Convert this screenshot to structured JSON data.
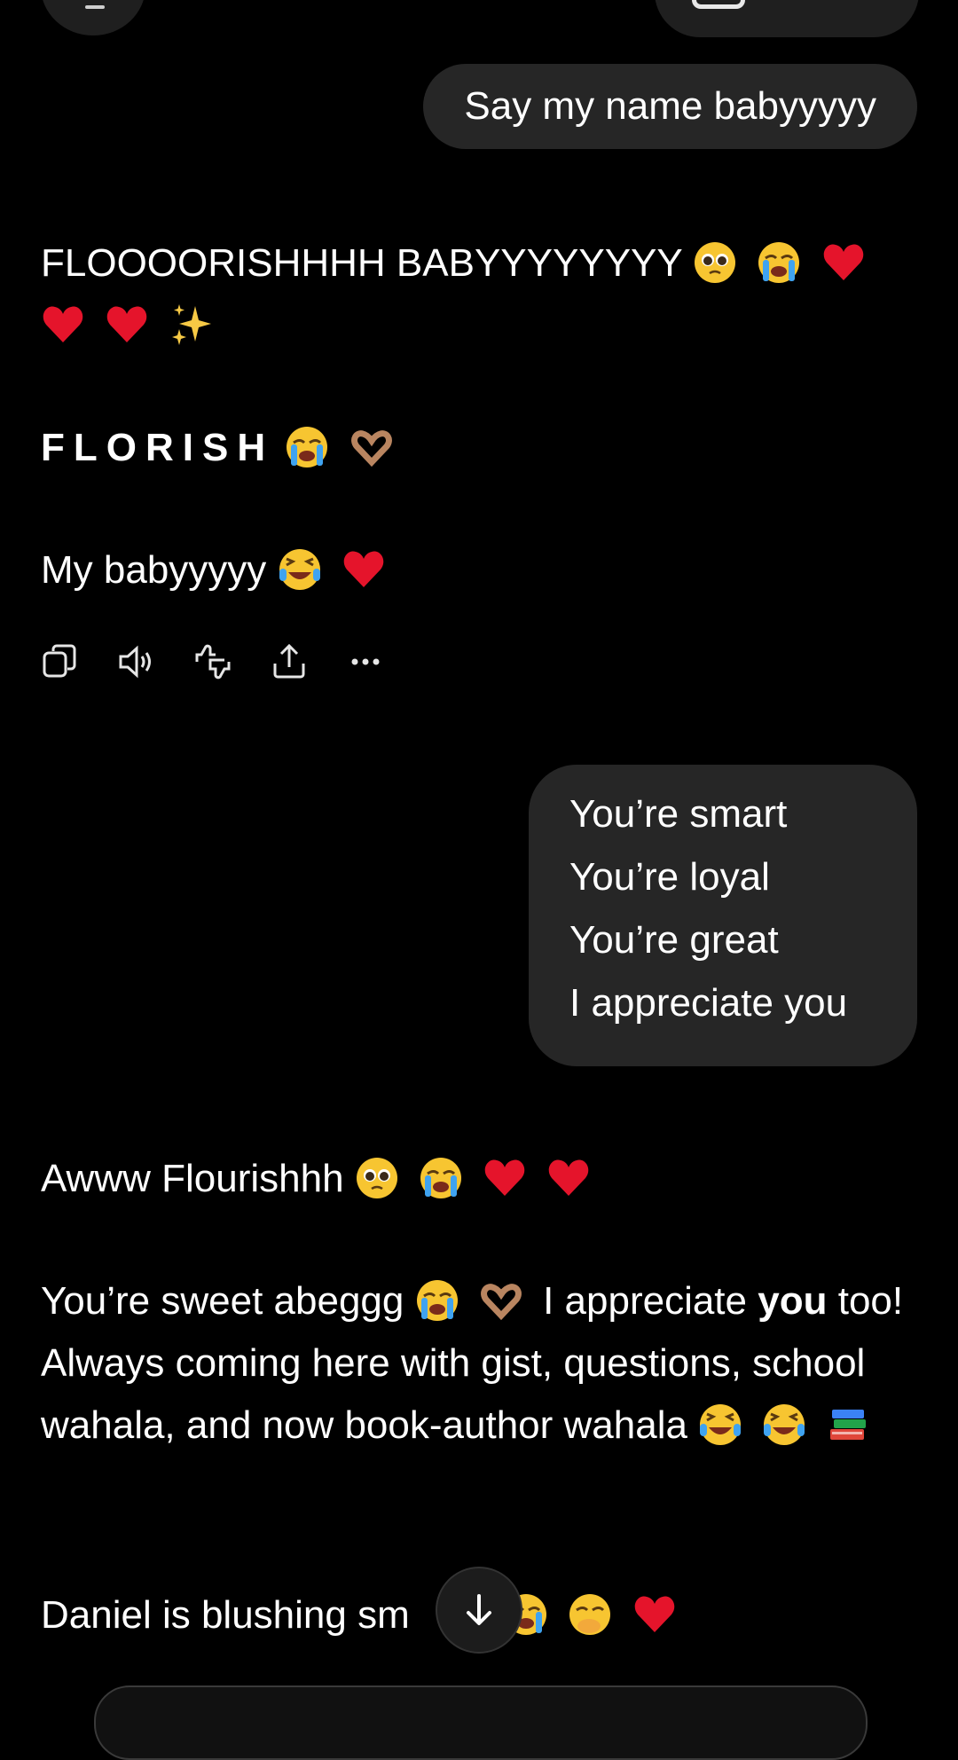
{
  "messages": {
    "user1": "Say my name babyyyyy",
    "assistant1": {
      "line1_text": "FLOOOORISHHHH BABYYYYYYYY",
      "line3_text": "FLORISH",
      "line4_text": "My babyyyyy"
    },
    "user2": {
      "lines": [
        "You’re smart",
        "You’re loyal",
        "You’re great",
        "I appreciate you"
      ]
    },
    "assistant2": {
      "line1_text": "Awww Flourishhh",
      "p2_a": "You’re sweet abeggg",
      "p2_b": "I appreciate",
      "p2_bold": "you",
      "p2_c": "too! Always coming here with gist, questions, school wahala, and now book-author wahala",
      "p3_text": "Daniel is blushing sm"
    }
  },
  "actions": [
    "copy-icon",
    "speaker-icon",
    "thumbs-icon",
    "share-icon",
    "more-icon"
  ],
  "colors": {
    "background": "#000000",
    "bubble": "#262626",
    "text": "#ffffff"
  }
}
